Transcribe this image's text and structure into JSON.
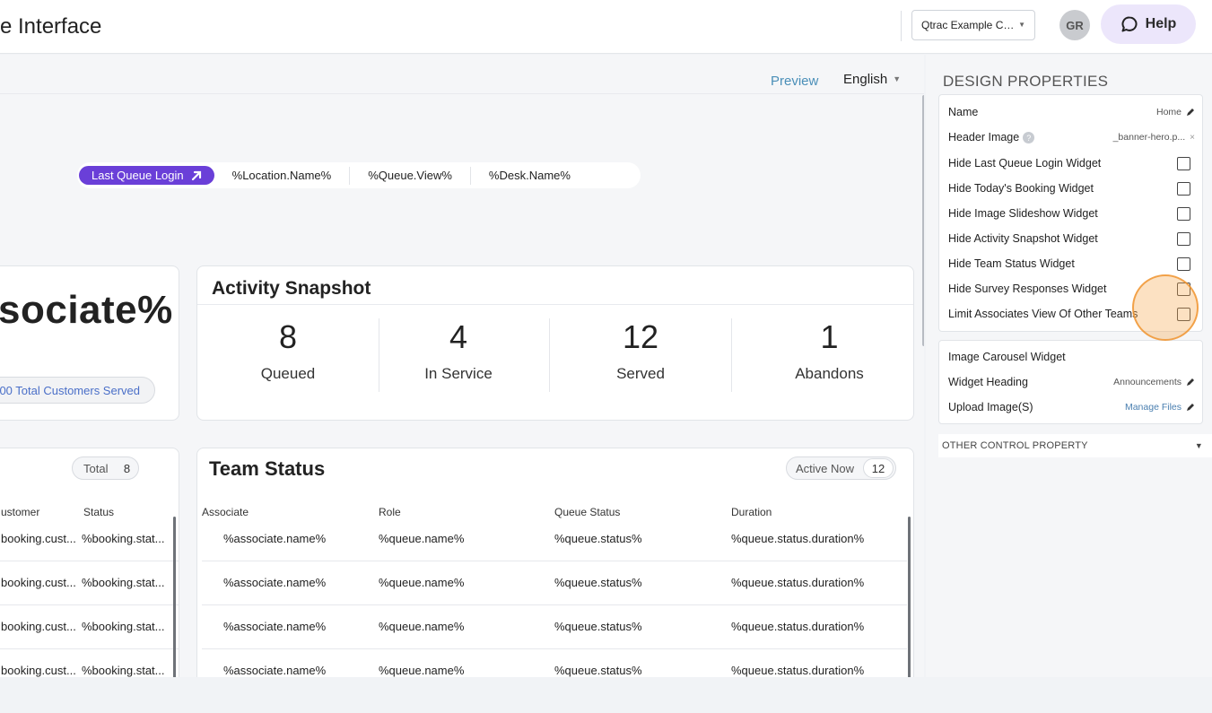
{
  "header": {
    "title": "e Interface",
    "org_select": "Qtrac Example C…",
    "avatar_initials": "GR",
    "help_label": "Help"
  },
  "toolbar": {
    "preview_label": "Preview",
    "language": "English"
  },
  "nav_pills": {
    "active": "Last Queue Login",
    "items": [
      "%Location.Name%",
      "%Queue.View%",
      "%Desk.Name%"
    ]
  },
  "associate_card": {
    "title": "sociate%",
    "served_label": "00 Total Customers Served"
  },
  "activity_snapshot": {
    "title": "Activity Snapshot",
    "stats": [
      {
        "value": "8",
        "label": "Queued"
      },
      {
        "value": "4",
        "label": "In Service"
      },
      {
        "value": "12",
        "label": "Served"
      },
      {
        "value": "1",
        "label": "Abandons"
      }
    ]
  },
  "bookings": {
    "total_label": "Total",
    "total_count": "8",
    "columns": [
      "ustomer",
      "Status"
    ],
    "rows": [
      [
        "booking.cust...",
        "%booking.stat..."
      ],
      [
        "booking.cust...",
        "%booking.stat..."
      ],
      [
        "booking.cust...",
        "%booking.stat..."
      ],
      [
        "booking.cust...",
        "%booking.stat..."
      ]
    ]
  },
  "team_status": {
    "title": "Team Status",
    "active_label": "Active Now",
    "active_count": "12",
    "columns": [
      "Associate",
      "Role",
      "Queue Status",
      "Duration"
    ],
    "rows": [
      [
        "%associate.name%",
        "%queue.name%",
        "%queue.status%",
        "%queue.status.duration%"
      ],
      [
        "%associate.name%",
        "%queue.name%",
        "%queue.status%",
        "%queue.status.duration%"
      ],
      [
        "%associate.name%",
        "%queue.name%",
        "%queue.status%",
        "%queue.status.duration%"
      ],
      [
        "%associate.name%",
        "%queue.name%",
        "%queue.status%",
        "%queue.status.duration%"
      ]
    ]
  },
  "design_properties": {
    "heading": "DESIGN PROPERTIES",
    "name_label": "Name",
    "name_value": "Home",
    "header_image_label": "Header Image",
    "header_image_value": "_banner-hero.p...",
    "checkboxes": [
      "Hide Last Queue Login Widget",
      "Hide Today's Booking Widget",
      "Hide Image Slideshow Widget",
      "Hide Activity Snapshot Widget",
      "Hide Team Status Widget",
      "Hide Survey Responses Widget",
      "Limit Associates View Of Other Teams"
    ],
    "carousel": {
      "title": "Image Carousel Widget",
      "heading_label": "Widget Heading",
      "heading_value": "Announcements",
      "upload_label": "Upload Image(S)",
      "upload_value": "Manage Files"
    },
    "other_property": "OTHER CONTROL PROPERTY"
  },
  "colors": {
    "accent_purple": "#6a3fd8",
    "help_bg": "#ece6fb",
    "link_blue": "#4a8fb8",
    "click_ring": "#f0a040"
  }
}
